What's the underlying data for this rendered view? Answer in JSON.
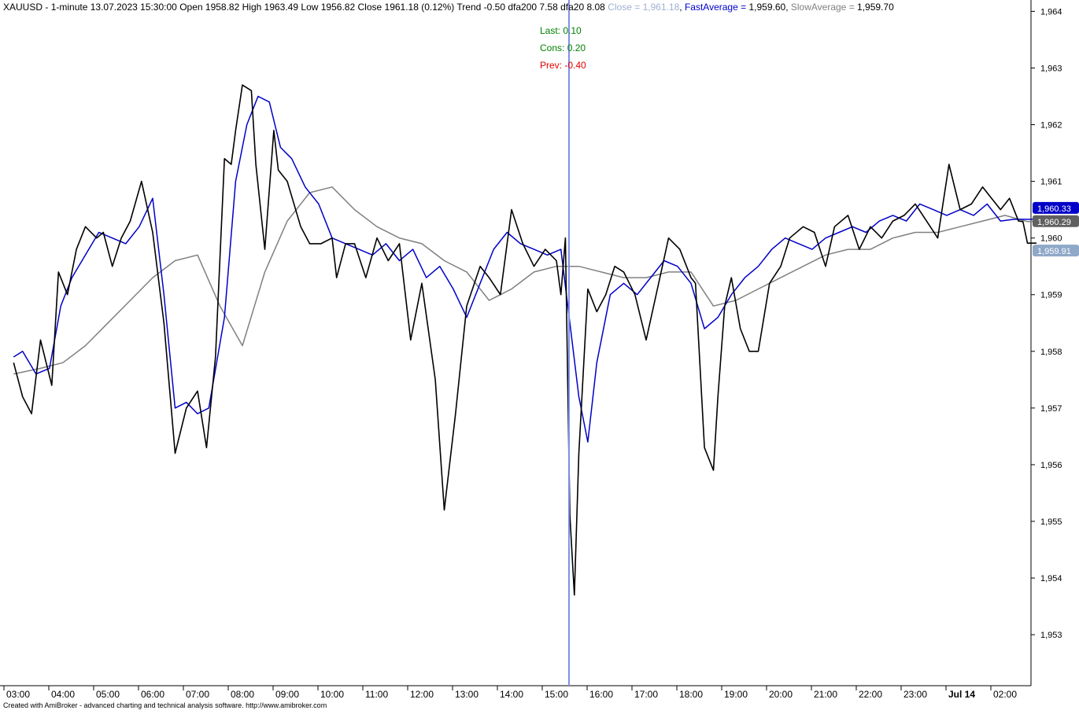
{
  "header": {
    "symbol": "XAUUSD",
    "interval": "1-minute",
    "datetime": "13.07.2023 15:30:00",
    "open_label": "Open",
    "open": "1958.82",
    "high_label": "High",
    "high": "1963.49",
    "low_label": "Low",
    "low": "1956.82",
    "close_label": "Close",
    "close": "1961.18",
    "change": "(0.12%)",
    "trend_label": "Trend",
    "trend": "-0.50",
    "dfa200_label": "dfa200",
    "dfa200": "7.58",
    "dfa20_label": "dfa20",
    "dfa20": "8.08",
    "close_eq_label": "Close",
    "close_eq": "1,961.18",
    "fast_label": "FastAverage",
    "fast": "1,959.60",
    "slow_label": "SlowAverage",
    "slow": "1,959.70"
  },
  "annotations": {
    "last_label": "Last:",
    "last": "0.10",
    "cons_label": "Cons:",
    "cons": "0.20",
    "prev_label": "Prev:",
    "prev": "-0.40"
  },
  "footer": {
    "credit": "Created with AmiBroker - advanced charting and technical analysis software. http://www.amibroker.com"
  },
  "colors": {
    "price": "#000000",
    "fast_average": "#0000c8",
    "slow_average": "#808080",
    "cursor": "#7f8fe8",
    "last": "#008000",
    "cons": "#008000",
    "prev": "#e00000",
    "badge_fast": "#0000c8",
    "badge_slow": "#606060",
    "badge_close": "#8fa8c8"
  },
  "chart_data": {
    "type": "line",
    "ylim": [
      1952.1,
      1964.2
    ],
    "y_ticks": [
      "1,964",
      "1,963",
      "1,962",
      "1,961",
      "1,960",
      "1,959",
      "1,958",
      "1,957",
      "1,956",
      "1,955",
      "1,954",
      "1,953"
    ],
    "x_ticks": [
      "03:00",
      "04:00",
      "05:00",
      "06:00",
      "07:00",
      "08:00",
      "09:00",
      "10:00",
      "11:00",
      "12:00",
      "13:00",
      "14:00",
      "15:00",
      "16:00",
      "17:00",
      "18:00",
      "19:00",
      "20:00",
      "21:00",
      "22:00",
      "23:00",
      "Jul 14",
      "02:00"
    ],
    "x_index": [
      0,
      1,
      2,
      3,
      4,
      5,
      6,
      7,
      8,
      9,
      10,
      11,
      12,
      13,
      14,
      15,
      16,
      17,
      18,
      19,
      20,
      21,
      22
    ],
    "bold_tick": "Jul 14",
    "cursor_hour": 12.28,
    "badges": [
      {
        "name": "fast",
        "value": "1,960.33"
      },
      {
        "name": "slow",
        "value": "1,960.29"
      },
      {
        "name": "close",
        "value": "1,959.91"
      }
    ],
    "series": [
      {
        "name": "Close",
        "x": [
          -0.1,
          0.1,
          0.3,
          0.5,
          0.75,
          0.9,
          1.1,
          1.3,
          1.5,
          1.75,
          1.9,
          2.1,
          2.3,
          2.5,
          2.75,
          3.0,
          3.25,
          3.5,
          3.75,
          4.0,
          4.2,
          4.4,
          4.6,
          4.75,
          4.85,
          5.0,
          5.2,
          5.3,
          5.5,
          5.7,
          5.8,
          6.0,
          6.3,
          6.5,
          6.75,
          7.0,
          7.1,
          7.3,
          7.5,
          7.75,
          8.0,
          8.25,
          8.5,
          8.75,
          9.0,
          9.3,
          9.5,
          9.75,
          10.0,
          10.3,
          10.5,
          10.75,
          11.0,
          11.25,
          11.5,
          11.75,
          12.0,
          12.1,
          12.2,
          12.3,
          12.4,
          12.5,
          12.7,
          12.9,
          13.1,
          13.3,
          13.5,
          13.75,
          14.0,
          14.25,
          14.5,
          14.75,
          15.0,
          15.1,
          15.3,
          15.5,
          15.6,
          15.75,
          15.9,
          16.1,
          16.3,
          16.5,
          16.75,
          17.0,
          17.2,
          17.5,
          17.75,
          18.0,
          18.2,
          18.5,
          18.75,
          19.0,
          19.25,
          19.5,
          19.75,
          20.0,
          20.25,
          20.5,
          20.75,
          21.0,
          21.25,
          21.5,
          21.7,
          21.9,
          22.1,
          22.3,
          22.4,
          22.5,
          22.7
        ],
        "values": [
          1957.8,
          1957.2,
          1956.9,
          1958.2,
          1957.4,
          1959.4,
          1959.0,
          1959.8,
          1960.2,
          1960.0,
          1960.1,
          1959.5,
          1960.0,
          1960.3,
          1961.0,
          1960.1,
          1958.5,
          1956.2,
          1957.0,
          1957.3,
          1956.3,
          1957.9,
          1961.4,
          1961.3,
          1961.9,
          1962.7,
          1962.6,
          1961.3,
          1959.8,
          1961.9,
          1961.2,
          1961.0,
          1960.2,
          1959.9,
          1959.9,
          1960.0,
          1959.3,
          1959.9,
          1959.9,
          1959.3,
          1960.0,
          1959.6,
          1959.9,
          1958.2,
          1959.2,
          1957.5,
          1955.2,
          1956.9,
          1958.8,
          1959.5,
          1959.3,
          1959.0,
          1960.5,
          1959.9,
          1959.5,
          1959.8,
          1959.6,
          1959.0,
          1960.0,
          1955.1,
          1953.7,
          1956.2,
          1959.1,
          1958.7,
          1959.0,
          1959.5,
          1959.4,
          1959.0,
          1958.2,
          1959.1,
          1960.0,
          1959.8,
          1959.3,
          1959.2,
          1956.3,
          1955.9,
          1957.2,
          1958.8,
          1959.3,
          1958.4,
          1958.0,
          1958.0,
          1959.2,
          1959.5,
          1960.0,
          1960.2,
          1960.1,
          1959.5,
          1960.2,
          1960.4,
          1959.8,
          1960.2,
          1960.0,
          1960.3,
          1960.4,
          1960.6,
          1960.3,
          1960.0,
          1961.3,
          1960.5,
          1960.6,
          1960.9,
          1960.7,
          1960.5,
          1960.7,
          1960.3,
          1960.29,
          1959.91,
          1959.91
        ]
      },
      {
        "name": "FastAverage",
        "x": [
          -0.1,
          0.1,
          0.4,
          0.7,
          0.95,
          1.2,
          1.5,
          1.8,
          2.1,
          2.4,
          2.7,
          3.0,
          3.25,
          3.5,
          3.75,
          4.0,
          4.25,
          4.6,
          4.85,
          5.1,
          5.35,
          5.6,
          5.85,
          6.1,
          6.4,
          6.7,
          7.0,
          7.3,
          7.6,
          7.9,
          8.2,
          8.5,
          8.8,
          9.1,
          9.4,
          9.7,
          10.0,
          10.3,
          10.6,
          10.9,
          11.2,
          11.5,
          11.8,
          12.1,
          12.3,
          12.5,
          12.7,
          12.9,
          13.2,
          13.5,
          13.8,
          14.1,
          14.4,
          14.7,
          15.0,
          15.3,
          15.6,
          15.9,
          16.2,
          16.5,
          16.8,
          17.1,
          17.4,
          17.7,
          18.0,
          18.3,
          18.6,
          18.9,
          19.2,
          19.5,
          19.8,
          20.1,
          20.4,
          20.7,
          21.0,
          21.3,
          21.6,
          21.9,
          22.2,
          22.5,
          22.7
        ],
        "values": [
          1957.9,
          1958.0,
          1957.6,
          1957.7,
          1958.8,
          1959.3,
          1959.7,
          1960.1,
          1960.0,
          1959.9,
          1960.2,
          1960.7,
          1959.0,
          1957.0,
          1957.1,
          1956.9,
          1957.0,
          1958.6,
          1961.0,
          1962.0,
          1962.5,
          1962.4,
          1961.6,
          1961.4,
          1960.9,
          1960.6,
          1960.0,
          1959.9,
          1959.8,
          1959.7,
          1959.9,
          1959.6,
          1959.8,
          1959.3,
          1959.5,
          1959.1,
          1958.6,
          1959.2,
          1959.8,
          1960.1,
          1959.9,
          1959.8,
          1959.7,
          1959.8,
          1958.5,
          1957.2,
          1956.4,
          1957.8,
          1959.0,
          1959.2,
          1959.0,
          1959.3,
          1959.6,
          1959.5,
          1959.2,
          1958.4,
          1958.6,
          1959.0,
          1959.3,
          1959.5,
          1959.8,
          1960.0,
          1959.9,
          1959.8,
          1960.0,
          1960.1,
          1960.2,
          1960.1,
          1960.3,
          1960.4,
          1960.3,
          1960.6,
          1960.5,
          1960.4,
          1960.5,
          1960.4,
          1960.6,
          1960.3,
          1960.33,
          1960.33,
          1960.33
        ]
      },
      {
        "name": "SlowAverage",
        "x": [
          -0.1,
          0.5,
          1.0,
          1.5,
          2.0,
          2.5,
          3.0,
          3.5,
          4.0,
          4.5,
          5.0,
          5.5,
          6.0,
          6.5,
          7.0,
          7.5,
          8.0,
          8.5,
          9.0,
          9.5,
          10.0,
          10.5,
          11.0,
          11.5,
          12.0,
          12.5,
          13.0,
          13.5,
          14.0,
          14.5,
          15.0,
          15.5,
          16.0,
          16.5,
          17.0,
          17.5,
          18.0,
          18.5,
          19.0,
          19.5,
          20.0,
          20.5,
          21.0,
          21.5,
          22.0,
          22.5,
          22.7
        ],
        "values": [
          1957.6,
          1957.7,
          1957.8,
          1958.1,
          1958.5,
          1958.9,
          1959.3,
          1959.6,
          1959.7,
          1958.8,
          1958.1,
          1959.4,
          1960.3,
          1960.8,
          1960.9,
          1960.5,
          1960.2,
          1960.0,
          1959.9,
          1959.6,
          1959.4,
          1958.9,
          1959.1,
          1959.4,
          1959.5,
          1959.5,
          1959.4,
          1959.3,
          1959.3,
          1959.4,
          1959.4,
          1958.8,
          1958.9,
          1959.1,
          1959.3,
          1959.5,
          1959.7,
          1959.8,
          1959.8,
          1960.0,
          1960.1,
          1960.1,
          1960.2,
          1960.3,
          1960.4,
          1960.29,
          1960.29
        ]
      }
    ]
  }
}
